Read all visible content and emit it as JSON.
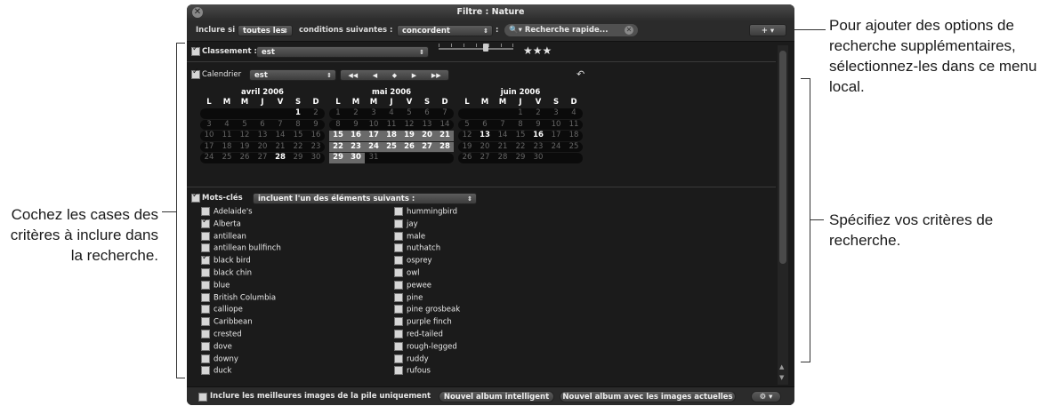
{
  "window": {
    "title": "Filtre : Nature"
  },
  "toolbar": {
    "include_if": "Inclure si",
    "match_value": "toutes les",
    "conditions_text": "conditions suivantes :",
    "conditions_value": "concordent",
    "colon": ":",
    "search_placeholder": "Recherche rapide...",
    "add_button": "+ ▾"
  },
  "rating": {
    "label": "Classement :",
    "operator": "est",
    "stars": "★★★",
    "level": 3,
    "checked": true
  },
  "calendar": {
    "label": "Calendrier",
    "operator": "est",
    "nav": [
      "◀◀",
      "◀",
      "◆",
      "▶",
      "▶▶"
    ],
    "months": [
      {
        "title": "avril 2006",
        "days": [
          "L",
          "M",
          "M",
          "J",
          "V",
          "S",
          "D"
        ],
        "rows": [
          [
            "",
            "",
            "",
            "",
            "",
            "1",
            "2"
          ],
          [
            "3",
            "4",
            "5",
            "6",
            "7",
            "8",
            "9"
          ],
          [
            "10",
            "11",
            "12",
            "13",
            "14",
            "15",
            "16"
          ],
          [
            "17",
            "18",
            "19",
            "20",
            "21",
            "22",
            "23"
          ],
          [
            "24",
            "25",
            "26",
            "27",
            "28",
            "29",
            "30"
          ]
        ]
      },
      {
        "title": "mai 2006",
        "days": [
          "L",
          "M",
          "M",
          "J",
          "V",
          "S",
          "D"
        ],
        "rows": [
          [
            "1",
            "2",
            "3",
            "4",
            "5",
            "6",
            "7"
          ],
          [
            "8",
            "9",
            "10",
            "11",
            "12",
            "13",
            "14"
          ],
          [
            "15",
            "16",
            "17",
            "18",
            "19",
            "20",
            "21"
          ],
          [
            "22",
            "23",
            "24",
            "25",
            "26",
            "27",
            "28"
          ],
          [
            "29",
            "30",
            "31",
            "",
            "",
            "",
            ""
          ]
        ]
      },
      {
        "title": "juin 2006",
        "days": [
          "L",
          "M",
          "M",
          "J",
          "V",
          "S",
          "D"
        ],
        "rows": [
          [
            "",
            "",
            "",
            "1",
            "2",
            "3",
            "4"
          ],
          [
            "5",
            "6",
            "7",
            "8",
            "9",
            "10",
            "11"
          ],
          [
            "12",
            "13",
            "14",
            "15",
            "16",
            "17",
            "18"
          ],
          [
            "19",
            "20",
            "21",
            "22",
            "23",
            "24",
            "25"
          ],
          [
            "26",
            "27",
            "28",
            "29",
            "30",
            "",
            ""
          ]
        ]
      }
    ],
    "checked": true
  },
  "keywords": {
    "label": "Mots-clés",
    "operator": "incluent l'un des éléments suivants :",
    "checked": true,
    "col1": [
      {
        "t": "Adelaide's",
        "c": false
      },
      {
        "t": "Alberta",
        "c": true
      },
      {
        "t": "antillean",
        "c": false
      },
      {
        "t": "antillean bullfinch",
        "c": false
      },
      {
        "t": "black bird",
        "c": true
      },
      {
        "t": "black chin",
        "c": false
      },
      {
        "t": "blue",
        "c": false
      },
      {
        "t": "British Columbia",
        "c": false
      },
      {
        "t": "calliope",
        "c": false
      },
      {
        "t": "Caribbean",
        "c": false
      },
      {
        "t": "crested",
        "c": false
      },
      {
        "t": "dove",
        "c": false
      },
      {
        "t": "downy",
        "c": false
      },
      {
        "t": "duck",
        "c": false
      }
    ],
    "col2": [
      {
        "t": "hummingbird",
        "c": false
      },
      {
        "t": "jay",
        "c": false
      },
      {
        "t": "male",
        "c": false
      },
      {
        "t": "nuthatch",
        "c": false
      },
      {
        "t": "osprey",
        "c": false
      },
      {
        "t": "owl",
        "c": false
      },
      {
        "t": "pewee",
        "c": false
      },
      {
        "t": "pine",
        "c": false
      },
      {
        "t": "pine grosbeak",
        "c": false
      },
      {
        "t": "purple finch",
        "c": false
      },
      {
        "t": "red-tailed",
        "c": false
      },
      {
        "t": "rough-legged",
        "c": false
      },
      {
        "t": "ruddy",
        "c": false
      },
      {
        "t": "rufous",
        "c": false
      }
    ]
  },
  "bottom": {
    "stack_label": "Inclure les meilleures images de la pile uniquement",
    "smart_album": "Nouvel album intelligent",
    "album_current": "Nouvel album avec les images actuelles",
    "gear": "⚙ ▾"
  },
  "annotations": {
    "top_right": "Pour ajouter des options de recherche supplémentaires, sélectionnez-les dans ce menu local.",
    "middle_right": "Spécifiez vos critères de recherche.",
    "left": "Cochez les cases des critères à inclure dans la recherche."
  }
}
